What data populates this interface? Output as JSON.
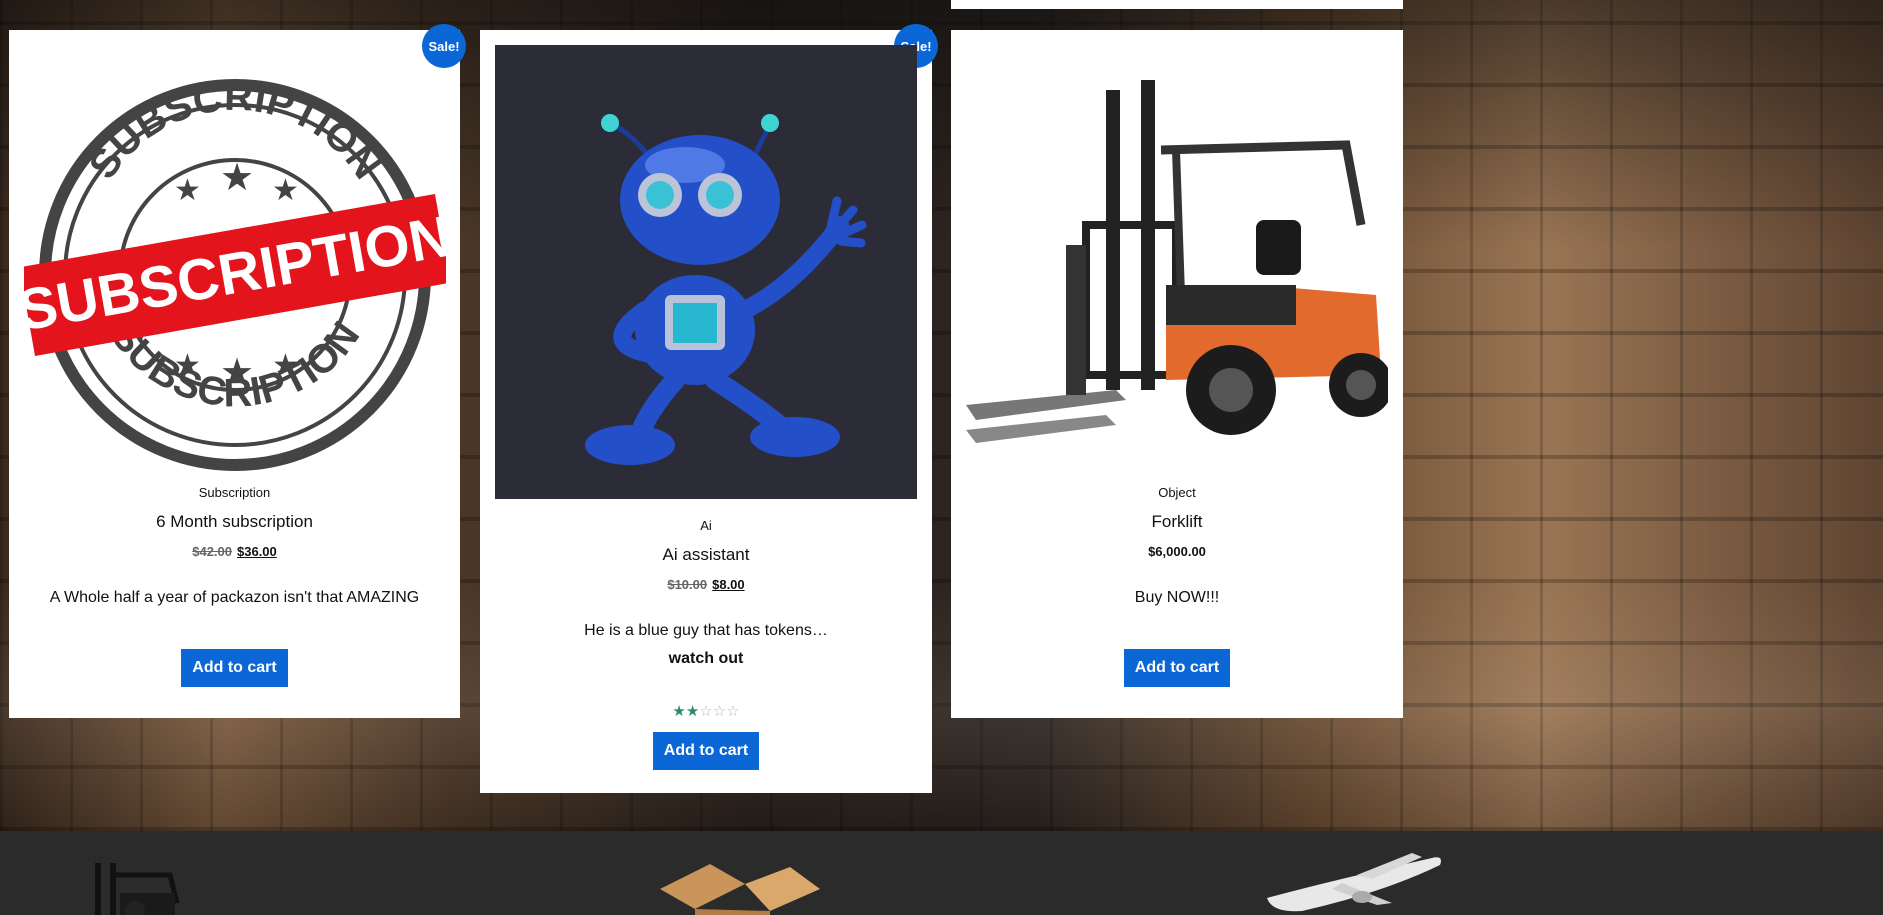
{
  "products": [
    {
      "badge": "Sale!",
      "category": "Subscription",
      "title": "6 Month subscription",
      "price_old": "$42.00",
      "price_new": "$36.00",
      "description": "A Whole half a year of packazon isn't that AMAZING",
      "button": "Add to cart",
      "image": "subscription-stamp-image",
      "stamp_text": [
        "SUBSCRIPTION",
        "SUBSCRIPTION",
        "SUBSCRIPTION"
      ]
    },
    {
      "badge": "Sale!",
      "category": "Ai",
      "title": "Ai assistant",
      "price_old": "$10.00",
      "price_new": "$8.00",
      "description": "He is a blue guy that has tokens…",
      "description_bold": "watch out",
      "rating": 2,
      "rating_max": 5,
      "button": "Add to cart",
      "image": "blue-robot-image"
    },
    {
      "category": "Object",
      "title": "Forklift",
      "price": "$6,000.00",
      "description": "Buy NOW!!!",
      "button": "Add to cart",
      "image": "forklift-image"
    }
  ],
  "footer_icons": [
    "forklift-icon",
    "box-icon",
    "airplane-icon"
  ],
  "colors": {
    "accent": "#0b66d6",
    "star": "#2e8b72",
    "footer": "#2b2b2b"
  }
}
